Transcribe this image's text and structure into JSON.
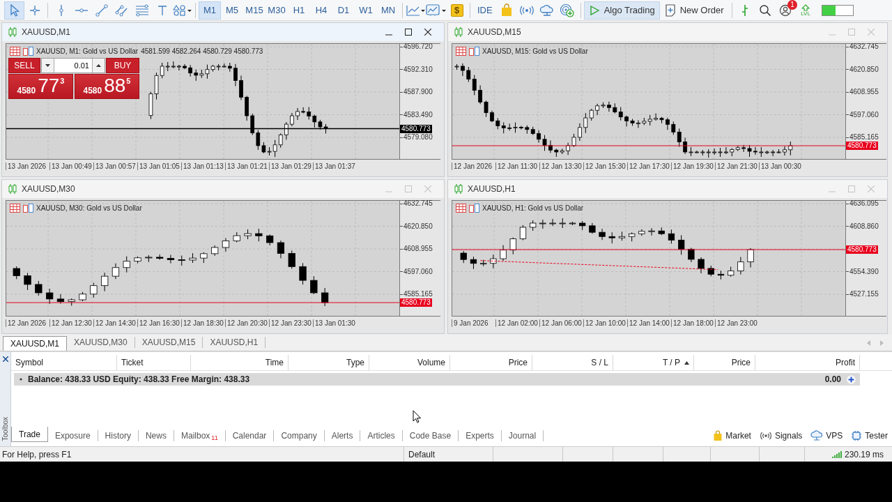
{
  "toolbar": {
    "cursor_selected": true,
    "timeframes": [
      {
        "label": "M1",
        "selected": true
      },
      {
        "label": "M5",
        "selected": false
      },
      {
        "label": "M15",
        "selected": false
      },
      {
        "label": "M30",
        "selected": false
      },
      {
        "label": "H1",
        "selected": false
      },
      {
        "label": "H4",
        "selected": false
      },
      {
        "label": "D1",
        "selected": false
      },
      {
        "label": "W1",
        "selected": false
      },
      {
        "label": "MN",
        "selected": false
      }
    ],
    "dollar": "$",
    "ide": "IDE",
    "algo_trading": {
      "label": "Algo Trading",
      "on": true
    },
    "new_order": "New Order",
    "notifications": "1",
    "lvl": "LVL",
    "meter": {
      "level": 0.45
    }
  },
  "charts": [
    {
      "title": "XAUUSD,M1",
      "active": true,
      "header": "XAUUSD, M1:  Gold vs US Dollar",
      "ohlc": "4581.599 4582.264 4580.729 4580.773",
      "price_ticks": [
        "4596.720",
        "4592.310",
        "4587.900",
        "4583.490",
        "4579.080"
      ],
      "price": {
        "text": "4580.773",
        "color": "#000000"
      },
      "time_labels": [
        "13 Jan 2026",
        "13 Jan 00:49",
        "13 Jan 00:57",
        "13 Jan 01:05",
        "13 Jan 01:13",
        "13 Jan 01:21",
        "13 Jan 01:29",
        "13 Jan 01:37"
      ],
      "trade_panel": {
        "sell": "SELL",
        "buy": "BUY",
        "volume": "0.01",
        "sell_price": {
          "big": "4580",
          "main": "77",
          "small": "3"
        },
        "buy_price": {
          "big": "4580",
          "main": "88",
          "small": "5"
        }
      }
    },
    {
      "title": "XAUUSD,M15",
      "active": false,
      "header": "XAUUSD, M15:  Gold vs US Dollar",
      "price_ticks": [
        "4632.745",
        "4620.850",
        "4608.955",
        "4597.060",
        "4585.165"
      ],
      "price": {
        "text": "4580.773",
        "color": "#e8001c"
      },
      "time_labels": [
        "12 Jan 2026",
        "12 Jan 11:30",
        "12 Jan 13:30",
        "12 Jan 15:30",
        "12 Jan 17:30",
        "12 Jan 19:30",
        "12 Jan 21:30",
        "13 Jan 00:30"
      ]
    },
    {
      "title": "XAUUSD,M30",
      "active": false,
      "header": "XAUUSD, M30:  Gold vs US Dollar",
      "price_ticks": [
        "4632.745",
        "4620.850",
        "4608.955",
        "4597.060",
        "4585.165"
      ],
      "price": {
        "text": "4580.773",
        "color": "#e8001c"
      },
      "time_labels": [
        "12 Jan 2026",
        "12 Jan 12:30",
        "12 Jan 14:30",
        "12 Jan 16:30",
        "12 Jan 18:30",
        "12 Jan 20:30",
        "12 Jan 23:30",
        "13 Jan 01:30"
      ]
    },
    {
      "title": "XAUUSD,H1",
      "active": false,
      "header": "XAUUSD, H1:  Gold vs US Dollar",
      "trend_line": true,
      "price_ticks": [
        "4636.095",
        "4608.860",
        "4554.390",
        "4527.155"
      ],
      "price": {
        "text": "4580.773",
        "color": "#e8001c"
      },
      "time_labels": [
        "9 Jan 2026",
        "12 Jan 02:00",
        "12 Jan 06:00",
        "12 Jan 10:00",
        "12 Jan 14:00",
        "12 Jan 18:00",
        "12 Jan 23:00"
      ]
    }
  ],
  "chart_tabs": [
    {
      "label": "XAUUSD,M1",
      "selected": true
    },
    {
      "label": "XAUUSD,M30",
      "selected": false
    },
    {
      "label": "XAUUSD,M15",
      "selected": false
    },
    {
      "label": "XAUUSD,H1",
      "selected": false
    }
  ],
  "toolbox": {
    "label": "Toolbox",
    "columns": [
      {
        "label": "Symbol",
        "sorted": false
      },
      {
        "label": "Ticket",
        "sorted": false
      },
      {
        "label": "Time",
        "sorted": false
      },
      {
        "label": "Type",
        "sorted": false
      },
      {
        "label": "Volume",
        "sorted": false
      },
      {
        "label": "Price",
        "sorted": false
      },
      {
        "label": "S / L",
        "sorted": false
      },
      {
        "label": "T / P",
        "sorted": true
      },
      {
        "label": "Price",
        "sorted": false
      },
      {
        "label": "Profit",
        "sorted": false
      }
    ],
    "summary": {
      "text": "Balance: 438.33 USD  Equity: 438.33  Free Margin: 438.33",
      "profit": "0.00"
    },
    "tabs": [
      {
        "label": "Trade",
        "selected": true
      },
      {
        "label": "Exposure",
        "selected": false
      },
      {
        "label": "History",
        "selected": false
      },
      {
        "label": "News",
        "selected": false
      },
      {
        "label": "Mailbox",
        "selected": false,
        "badge": "11"
      },
      {
        "label": "Calendar",
        "selected": false
      },
      {
        "label": "Company",
        "selected": false
      },
      {
        "label": "Alerts",
        "selected": false
      },
      {
        "label": "Articles",
        "selected": false
      },
      {
        "label": "Code Base",
        "selected": false
      },
      {
        "label": "Experts",
        "selected": false
      },
      {
        "label": "Journal",
        "selected": false
      }
    ],
    "services": [
      {
        "label": "Market",
        "kind": "market"
      },
      {
        "label": "Signals",
        "kind": "signals"
      },
      {
        "label": "VPS",
        "kind": "vps"
      },
      {
        "label": "Tester",
        "kind": "tester"
      }
    ]
  },
  "status_bar": {
    "help": "For Help, press F1",
    "profile": "Default",
    "ping": "230.19 ms"
  }
}
